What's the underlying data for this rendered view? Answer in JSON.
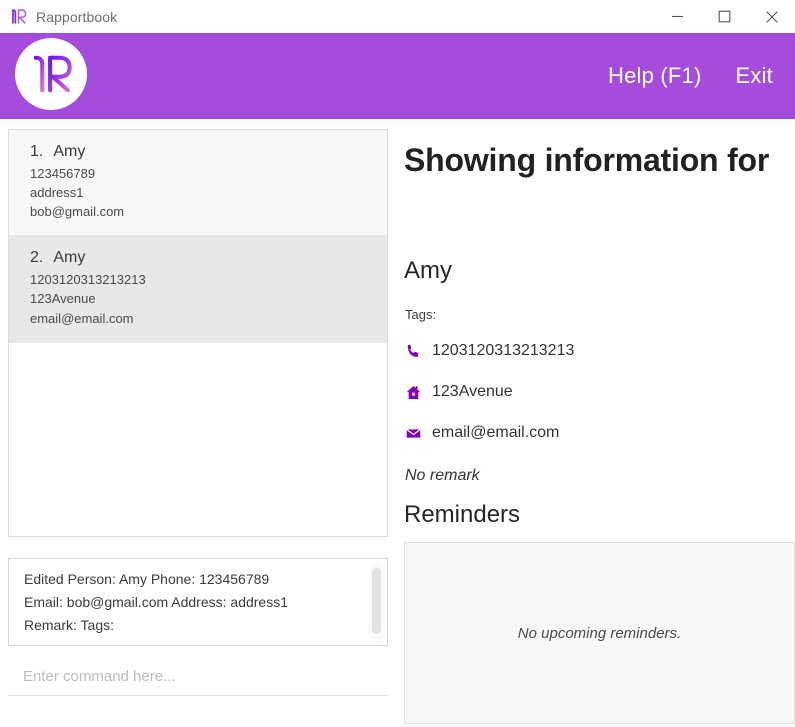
{
  "window": {
    "app_title": "Rapportbook",
    "logo_icon": "rapportbook-r-logo",
    "controls": {
      "minimize": "minimize-icon",
      "maximize": "maximize-icon",
      "close": "close-icon"
    }
  },
  "header": {
    "brand_logo_icon": "rapportbook-circle-logo",
    "accent_color": "#a54cdd",
    "menu": [
      {
        "label": "Help (F1)",
        "name": "help-menu-item"
      },
      {
        "label": "Exit",
        "name": "exit-menu-item"
      }
    ]
  },
  "person_list": [
    {
      "index": "1.",
      "name": "Amy",
      "phone": "123456789",
      "address": "address1",
      "email": "bob@gmail.com",
      "selected": false
    },
    {
      "index": "2.",
      "name": "Amy",
      "phone": "1203120313213213",
      "address": "123Avenue",
      "email": "email@email.com",
      "selected": true
    }
  ],
  "result_display": {
    "lines": [
      "Edited Person: Amy Phone: 123456789",
      "Email: bob@gmail.com Address: address1",
      "Remark:  Tags:"
    ]
  },
  "command_box": {
    "value": "",
    "placeholder": "Enter command here..."
  },
  "detail": {
    "heading": "Showing information for",
    "name": "Amy",
    "tags_label": "Tags:",
    "icon_color": "#8800bb",
    "fields": [
      {
        "icon": "phone-icon",
        "value": "1203120313213213"
      },
      {
        "icon": "home-icon",
        "value": "123Avenue"
      },
      {
        "icon": "email-icon",
        "value": "email@email.com"
      }
    ],
    "remark": "No remark",
    "reminders_heading": "Reminders",
    "reminders_empty": "No upcoming reminders."
  }
}
